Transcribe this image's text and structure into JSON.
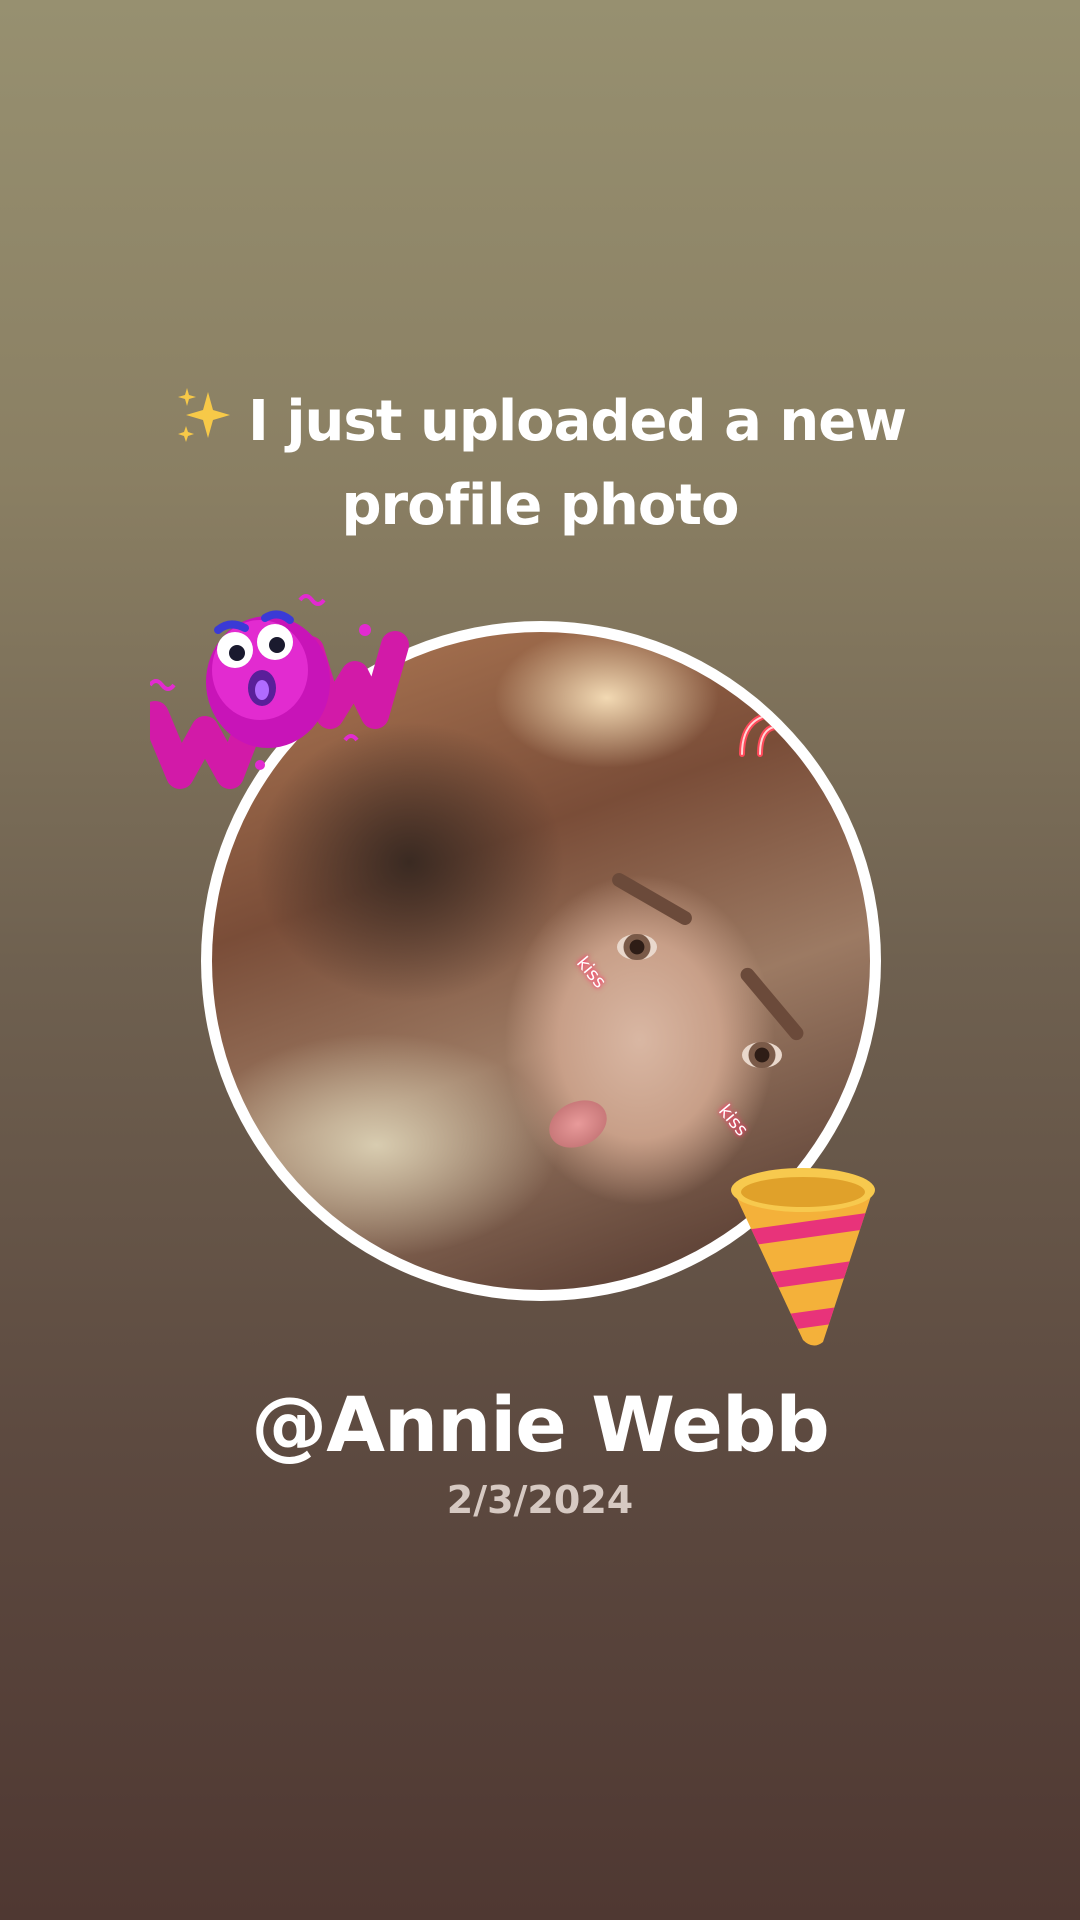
{
  "headline": {
    "icon": "sparkles-icon",
    "line1": "I just uploaded a new",
    "line2": "profile photo"
  },
  "profile": {
    "photo_stickers": [
      "wow-sticker",
      "party-popper-icon",
      "kiss",
      "kiss"
    ],
    "kiss_label_1": "kiss",
    "kiss_label_2": "kiss"
  },
  "user": {
    "name": "@Annie Webb",
    "date": "2/3/2024"
  },
  "colors": {
    "background_top": "#979070",
    "background_bottom": "#4f3832",
    "ring": "#ffffff",
    "text": "#ffffff",
    "date_text": "#d6c9c2"
  }
}
